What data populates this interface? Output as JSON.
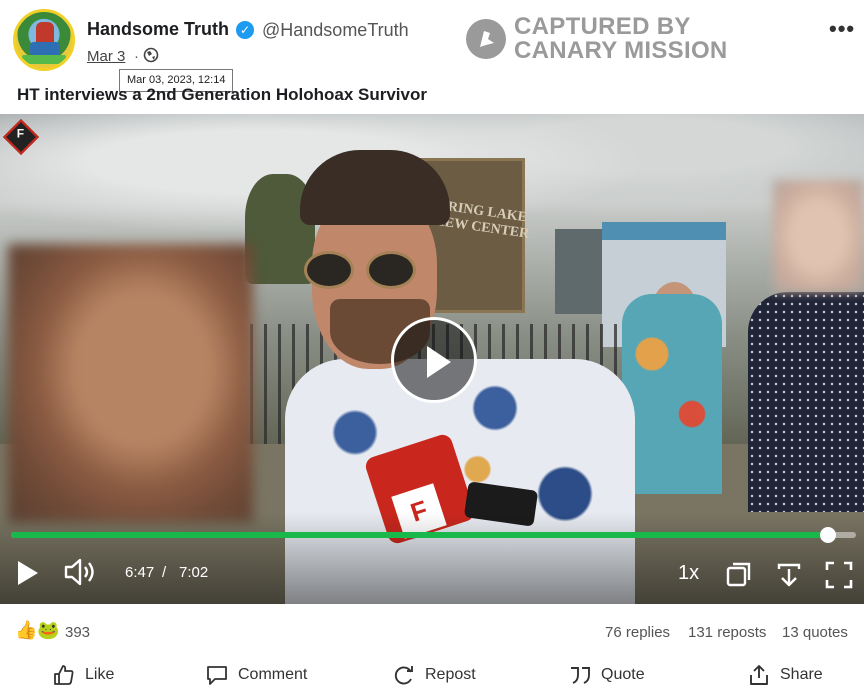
{
  "post": {
    "author_name": "Handsome Truth",
    "verified_mark": "✓",
    "handle": "@HandsomeTruth",
    "date": "Mar 3",
    "separator": "·",
    "date_tooltip": "Mar 03, 2023, 12:14",
    "text": "HT interviews a 2nd Generation Holohoax Survivor",
    "menu": "•••"
  },
  "watermark": {
    "line1": "CAPTURED BY",
    "line2": "CANARY MISSION"
  },
  "video": {
    "current_time": "6:47",
    "time_separator": "/",
    "total_time": "7:02",
    "speed": "1x",
    "progress_fraction": 0.9667,
    "progress_color": "#18b84a",
    "overlay_logo_text": "F",
    "building_sign": "SPRING LAKE VIEW CENTER"
  },
  "stats": {
    "reaction_icons": "👍🐸",
    "reaction_count": "393",
    "replies": "76 replies",
    "reposts": "131 reposts",
    "quotes": "13 quotes"
  },
  "actions": {
    "like": "Like",
    "comment": "Comment",
    "repost": "Repost",
    "quote": "Quote",
    "share": "Share"
  }
}
